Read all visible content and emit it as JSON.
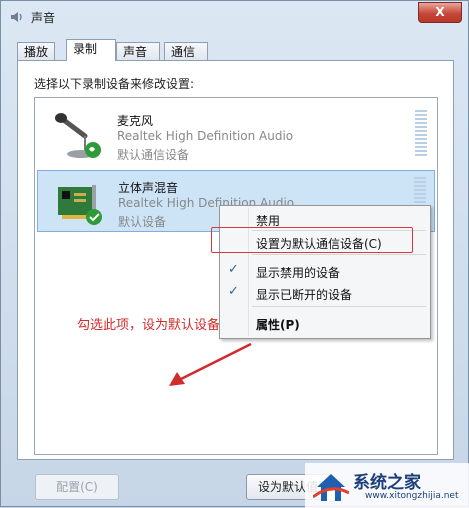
{
  "window": {
    "title": "声音",
    "close_label": "X"
  },
  "tabs": [
    {
      "label": "播放"
    },
    {
      "label": "录制"
    },
    {
      "label": "声音"
    },
    {
      "label": "通信"
    }
  ],
  "panel": {
    "instruction": "选择以下录制设备来修改设置:"
  },
  "devices": [
    {
      "name": "麦克风",
      "description": "Realtek High Definition Audio",
      "status": "默认通信设备"
    },
    {
      "name": "立体声混音",
      "description": "Realtek High Definition Audio",
      "status": "默认设备"
    }
  ],
  "context_menu": {
    "items": [
      {
        "label": "禁用",
        "checked": false
      },
      {
        "label": "设置为默认通信设备(C)",
        "checked": false
      },
      {
        "label": "显示禁用的设备",
        "checked": true
      },
      {
        "label": "显示已断开的设备",
        "checked": true
      },
      {
        "label": "属性(P)",
        "checked": false
      }
    ],
    "check_glyph": "✓"
  },
  "annotation": {
    "text": "勾选此项，设为默认设备"
  },
  "buttons": {
    "configure": "配置(C)",
    "set_default": "设为默认值"
  },
  "watermark": {
    "brand": "系统之家",
    "url": "www.xitongzhijia.net"
  },
  "colors": {
    "accent": "#3a5fa5",
    "annotation": "#d12b2b",
    "selection": "#cde4f7"
  }
}
